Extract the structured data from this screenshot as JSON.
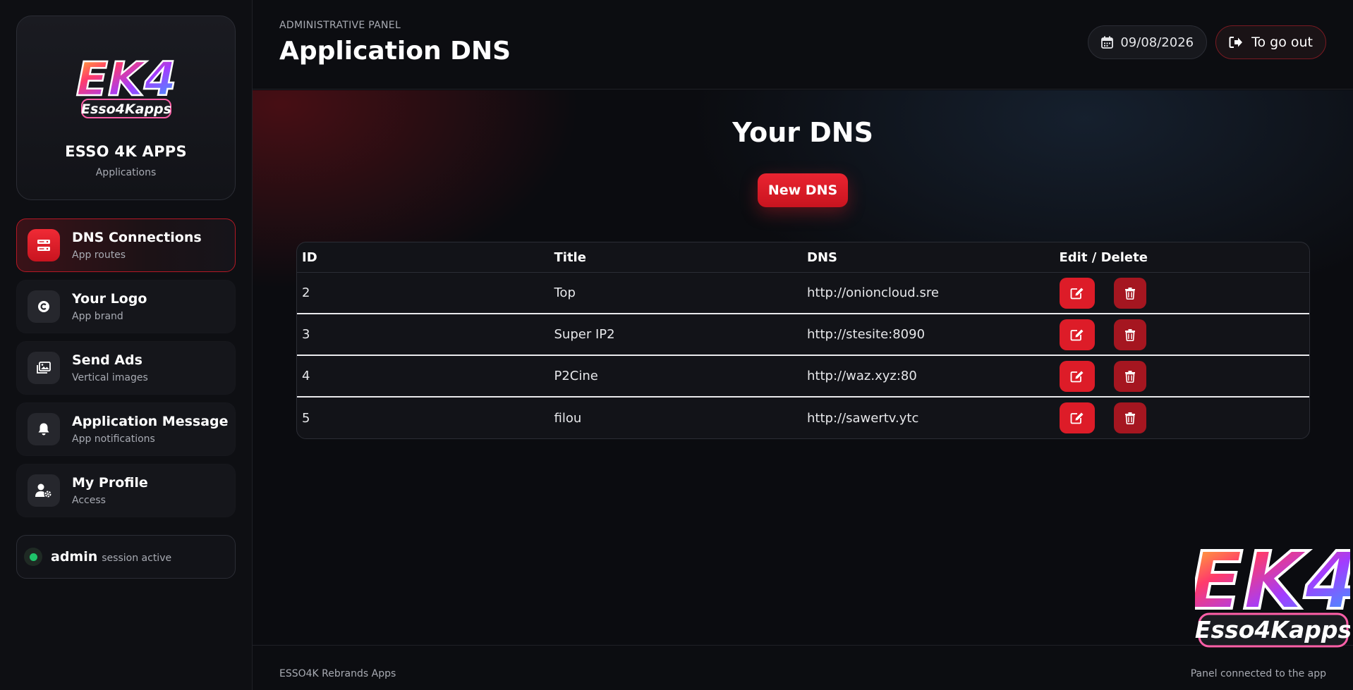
{
  "brand": {
    "logo_text_top": "EK4",
    "logo_text_bottom": "Esso4Kapps",
    "title": "ESSO 4K APPS",
    "subtitle": "Applications"
  },
  "sidebar": {
    "items": [
      {
        "label": "DNS Connections",
        "sub": "App routes",
        "icon": "server-icon",
        "active": true
      },
      {
        "label": "Your Logo",
        "sub": "App brand",
        "icon": "copyright-icon",
        "active": false
      },
      {
        "label": "Send Ads",
        "sub": "Vertical images",
        "icon": "images-icon",
        "active": false
      },
      {
        "label": "Application Message",
        "sub": "App notifications",
        "icon": "bell-icon",
        "active": false
      },
      {
        "label": "My Profile",
        "sub": "Access",
        "icon": "user-gear-icon",
        "active": false
      }
    ],
    "session": {
      "user": "admin",
      "status": "session active",
      "status_color": "#1fc46b"
    }
  },
  "header": {
    "eyebrow": "ADMINISTRATIVE PANEL",
    "title": "Application DNS",
    "date": "09/08/2026",
    "logout_label": "To go out"
  },
  "main": {
    "section_title": "Your DNS",
    "new_button_label": "New DNS",
    "table": {
      "columns": [
        "ID",
        "Title",
        "DNS",
        "Edit / Delete"
      ],
      "rows": [
        {
          "id": "2",
          "title": "Top",
          "dns": "http://onioncloud.sre"
        },
        {
          "id": "3",
          "title": "Super IP2",
          "dns": "http://stesite:8090"
        },
        {
          "id": "4",
          "title": "P2Cine",
          "dns": "http://waz.xyz:80"
        },
        {
          "id": "5",
          "title": "filou",
          "dns": "http://sawertv.ytc"
        }
      ]
    }
  },
  "footer": {
    "left": "ESSO4K Rebrands Apps",
    "right": "Panel connected to the app"
  },
  "colors": {
    "accent": "#dd1c28",
    "accent_dark": "#a51620",
    "background": "#0b0c10",
    "panel": "#121318"
  }
}
